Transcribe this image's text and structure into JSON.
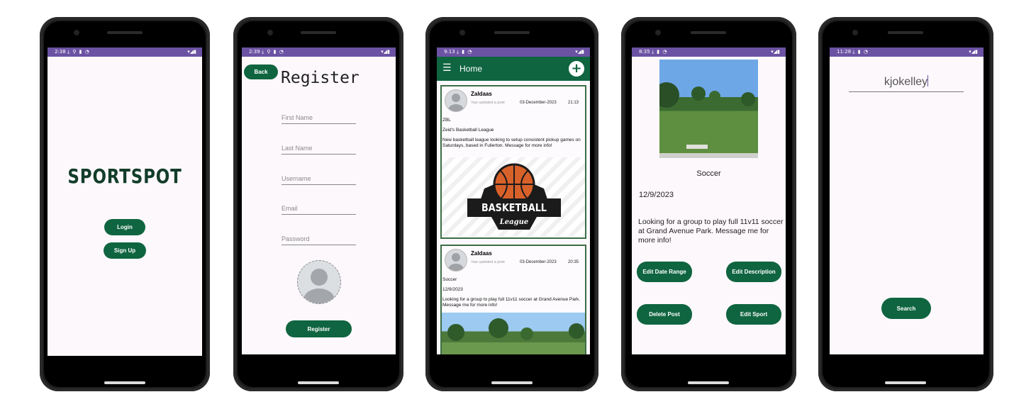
{
  "screens": {
    "splash": {
      "time": "2:38",
      "logo": "SPORTSPOT",
      "login_label": "Login",
      "signup_label": "Sign Up"
    },
    "register": {
      "time": "2:39",
      "back_label": "Back",
      "title": "Register",
      "first_name_placeholder": "First Name",
      "last_name_placeholder": "Last Name",
      "username_placeholder": "Username",
      "email_placeholder": "Email",
      "password_placeholder": "Password",
      "register_label": "Register"
    },
    "home": {
      "time": "9:13",
      "title": "Home",
      "posts": [
        {
          "user": "Zaldaas",
          "action": "has updated a post",
          "date": "03-December-2023",
          "time": "21:13",
          "line1": "ZBL",
          "line2": "Zeid's Basketball League",
          "body": "New basketball league looking to setup consistent pickup games on Saturdays, based in Fullerton. Message for more info!",
          "logo_main": "BASKETBALL",
          "logo_sub": "League"
        },
        {
          "user": "Zaldaas",
          "action": "has updated a post",
          "date": "03-December-2023",
          "time": "20:35",
          "line1": "Soccer",
          "line2": "12/9/2023",
          "body": "Looking for a group to play full 11v11 soccer at Grand Avenue Park. Message me for more info!"
        }
      ]
    },
    "post_detail": {
      "time": "8:35",
      "sport": "Soccer",
      "date": "12/9/2023",
      "description": "Looking for a group to play full 11v11 soccer at Grand Avenue Park. Message me for more info!",
      "edit_date_label": "Edit Date Range",
      "edit_desc_label": "Edit Description",
      "delete_label": "Delete Post",
      "edit_sport_label": "Edit Sport"
    },
    "search": {
      "time": "11:28",
      "query": "kjokelley",
      "search_label": "Search"
    }
  },
  "colors": {
    "brand_green": "#0f6540",
    "status_purple": "#6b52a3",
    "screen_bg": "#fdf8fc"
  }
}
